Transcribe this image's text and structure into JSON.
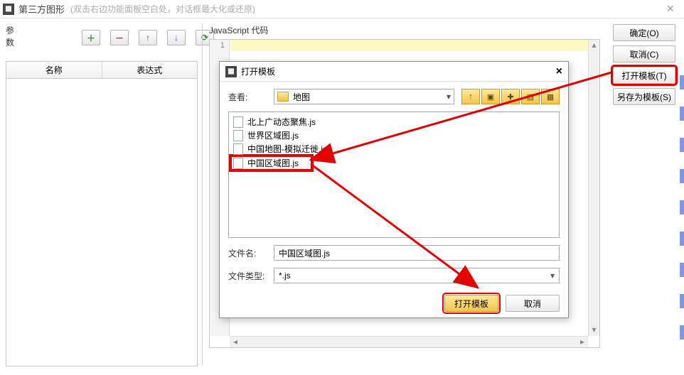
{
  "window": {
    "title": "第三方图形",
    "subtitle": "(双击右边功能面板空白处，对话框最大化或还原)"
  },
  "leftPanel": {
    "paramsLabel": "参数",
    "columns": {
      "name": "名称",
      "expr": "表达式"
    }
  },
  "jsPanel": {
    "label": "JavaScript 代码",
    "lineNum": "1"
  },
  "rightButtons": {
    "ok": "确定(O)",
    "cancel": "取消(C)",
    "openTemplate": "打开模板(T)",
    "saveTemplate": "另存为模板(S)"
  },
  "dialog": {
    "title": "打开模板",
    "lookInLabel": "查看:",
    "lookInValue": "地图",
    "files": [
      "北上广动态聚焦.js",
      "世界区域图.js",
      "中国地图-模拟迁徙.js",
      "中国区域图.js"
    ],
    "selectedIndex": 3,
    "fileNameLabel": "文件名:",
    "fileNameValue": "中国区域图.js",
    "fileTypeLabel": "文件类型:",
    "fileTypeValue": "*.js",
    "openBtn": "打开模板",
    "cancelBtn": "取消"
  }
}
